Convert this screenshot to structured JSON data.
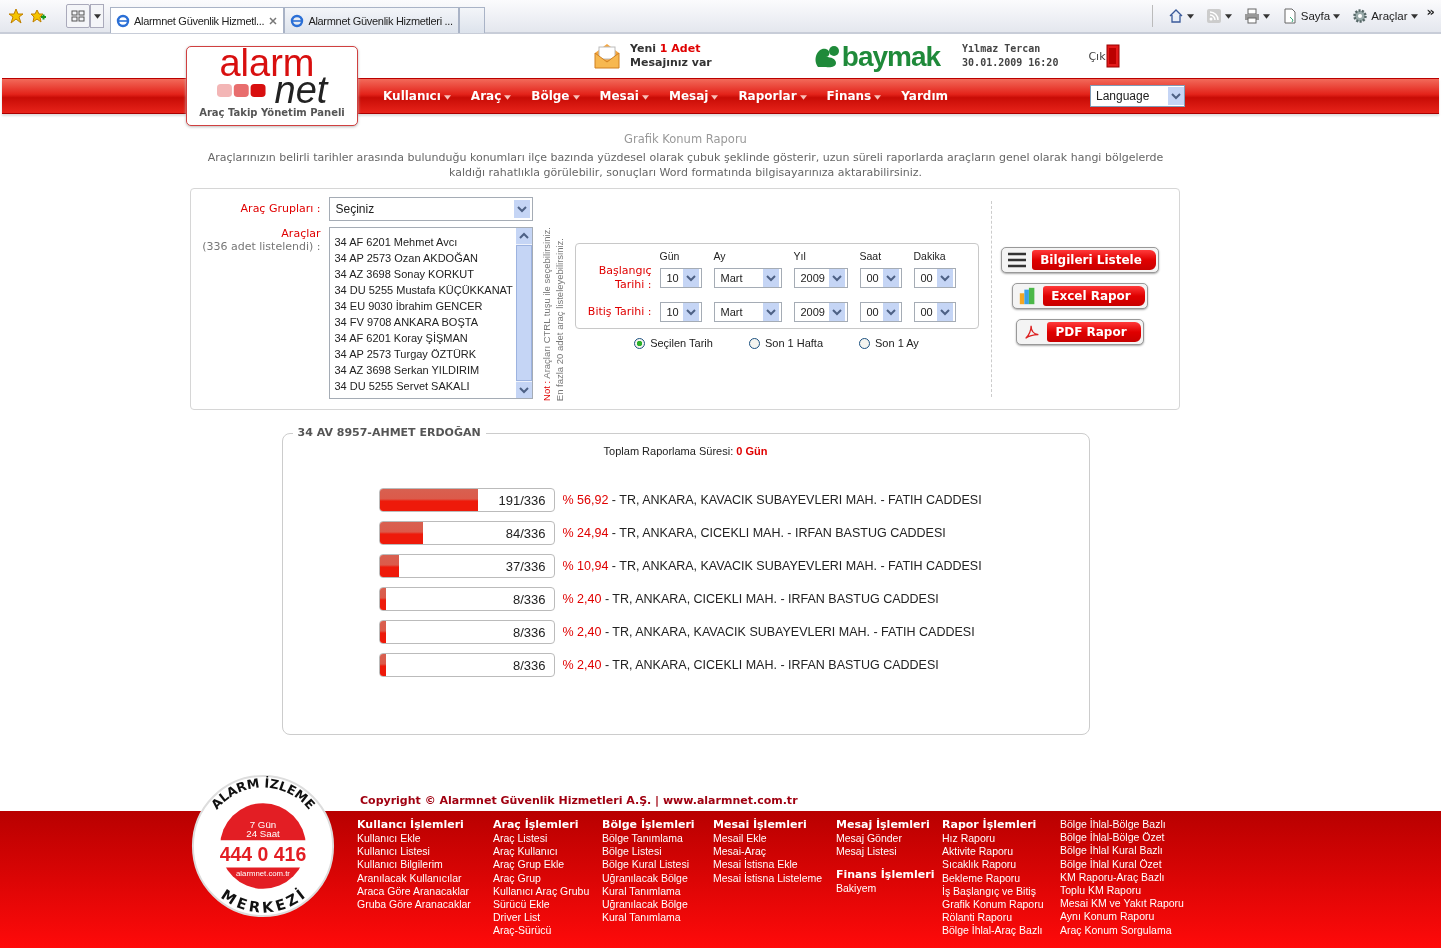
{
  "browser": {
    "tabs": [
      {
        "title": "Alarmnet Güvenlik Hizmetl...",
        "selected": true
      },
      {
        "title": "Alarmnet Güvenlik Hizmetleri ...",
        "selected": false
      }
    ],
    "tools": [
      {
        "kind": "home"
      },
      {
        "kind": "feed"
      },
      {
        "kind": "print"
      },
      {
        "kind": "page",
        "label": "Sayfa"
      },
      {
        "kind": "gear",
        "label": "Araçlar"
      }
    ],
    "more": "»"
  },
  "header": {
    "logo": {
      "word1": "alarm",
      "word2": "net",
      "tagline": "Araç Takip Yönetim Paneli"
    },
    "message": {
      "prefix": "Yeni",
      "count": "1 Adet",
      "text": "Mesajınız var"
    },
    "brand": "baymak",
    "user": "Yılmaz Tercan",
    "datetime": "30.01.2009 16:20",
    "logout": "Çık",
    "nav": [
      {
        "label": "Kullanıcı",
        "has_menu": true
      },
      {
        "label": "Araç",
        "has_menu": true
      },
      {
        "label": "Bölge",
        "has_menu": true
      },
      {
        "label": "Mesai",
        "has_menu": true
      },
      {
        "label": "Mesaj",
        "has_menu": true
      },
      {
        "label": "Raporlar",
        "has_menu": true
      },
      {
        "label": "Finans",
        "has_menu": true
      },
      {
        "label": "Yardım",
        "has_menu": false
      }
    ],
    "language": "Language"
  },
  "page": {
    "title": "Grafik Konum Raporu",
    "description": "Araçlarınızın belirli tarihler arasında bulunduğu konumları ilçe bazında yüzdesel olarak çubuk şeklinde gösterir, uzun süreli raporlarda araçların genel olarak hangi bölgelerde kaldığı rahatlıkla görülebilir, sonuçları Word formatında bilgisayarınıza aktarabilirsiniz."
  },
  "form": {
    "group_label": "Araç Grupları :",
    "group_value": "Seçiniz",
    "vehicles_label": "Araçlar",
    "vehicles_count": "(336 adet listelendi) :",
    "vehicles": [
      "34 AF 6201 Mehmet Avcı",
      "34 AP 2573 Ozan AKDOĞAN",
      "34 AZ 3698 Sonay KORKUT",
      "34 DU 5255 Mustafa KÜÇÜKKANAT",
      "34 EU 9030 İbrahim GENCER",
      "34 FV 9708 ANKARA BOŞTA",
      "34 AF 6201 Koray ŞİŞMAN",
      "34 AP 2573 Turgay ÖZTÜRK",
      "34 AZ 3698 Serkan YILDIRIM",
      "34 DU 5255 Servet SAKALI"
    ],
    "note_prefix": "Not :",
    "note_lines": [
      "Araçları CTRL tuşu ile seçebilirsiniz.",
      "En fazla 20 adet araç listeleyebilirsiniz."
    ],
    "date_columns": [
      "Gün",
      "Ay",
      "Yıl",
      "Saat",
      "Dakika"
    ],
    "date_rows": [
      {
        "label": "Başlangıç Tarihi :",
        "values": [
          "10",
          "Mart",
          "2009",
          "00",
          "00"
        ]
      },
      {
        "label": "Bitiş Tarihi :",
        "values": [
          "10",
          "Mart",
          "2009",
          "00",
          "00"
        ]
      }
    ],
    "ranges": [
      {
        "label": "Seçilen Tarih",
        "selected": true
      },
      {
        "label": "Son 1 Hafta",
        "selected": false
      },
      {
        "label": "Son 1 Ay",
        "selected": false
      }
    ],
    "buttons": [
      {
        "label": "Bilgileri Listele",
        "kind": "list"
      },
      {
        "label": "Excel Rapor",
        "kind": "excel"
      },
      {
        "label": "PDF Rapor",
        "kind": "pdf"
      }
    ]
  },
  "report": {
    "title": "34 AV 8957-AHMET ERDOĞAN",
    "total_label": "Toplam Raporlama Süresi:",
    "total_value": "0 Gün",
    "rows": [
      {
        "level": 0.5685,
        "count": "191/336",
        "percent": "% 56,92",
        "address": "- TR, ANKARA, KAVACIK SUBAYEVLERI MAH. - FATIH CADDESI"
      },
      {
        "level": 0.25,
        "count": "84/336",
        "percent": "% 24,94",
        "address": "- TR, ANKARA, CICEKLI MAH. - IRFAN BASTUG CADDESI"
      },
      {
        "level": 0.11,
        "count": "37/336",
        "percent": "% 10,94",
        "address": "- TR, ANKARA, KAVACIK SUBAYEVLERI MAH. - FATIH CADDESI"
      },
      {
        "level": 0.024,
        "count": "8/336",
        "percent": "% 2,40",
        "address": "- TR, ANKARA, CICEKLI MAH. - IRFAN BASTUG CADDESI"
      },
      {
        "level": 0.024,
        "count": "8/336",
        "percent": "% 2,40",
        "address": "- TR, ANKARA, KAVACIK SUBAYEVLERI MAH. - FATIH CADDESI"
      },
      {
        "level": 0.024,
        "count": "8/336",
        "percent": "% 2,40",
        "address": "- TR, ANKARA, CICEKLI MAH. - IRFAN BASTUG CADDESI"
      }
    ]
  },
  "footer": {
    "badge": {
      "top": "ALARM İZLEME",
      "days": "7 Gün",
      "hours": "24 Saat",
      "phone": "444 0 416",
      "site": "alarmnet.com.tr",
      "bottom": "MERKEZİ"
    },
    "copyright": "Copyright © Alarmnet Güvenlik Hizmetleri A.Ş. | www.alarmnet.com.tr",
    "columns": [
      {
        "sections": [
          {
            "title": "Kullancı İşlemleri",
            "links": [
              "Kullanıcı Ekle",
              "Kullanıcı Listesi",
              "Kullanıcı Bilgilerim",
              "Aranılacak Kullanıcılar",
              "Araca Göre Aranacaklar",
              "Gruba Göre Aranacaklar"
            ]
          }
        ]
      },
      {
        "sections": [
          {
            "title": "Araç İşlemleri",
            "links": [
              "Araç Listesi",
              "Araç Kullanıcı",
              "Araç Grup Ekle",
              "Araç Grup",
              "Kullanıcı Araç Grubu",
              "Sürücü Ekle",
              "Driver List",
              "Araç-Sürücü"
            ]
          }
        ]
      },
      {
        "sections": [
          {
            "title": "Bölge İşlemleri",
            "links": [
              "Bölge Tanımlama",
              "Bölge Listesi",
              "Bölge Kural Listesi",
              "Uğranılacak Bölge",
              "Kural Tanımlama",
              "Uğranılacak Bölge",
              "Kural Tanımlama"
            ]
          }
        ]
      },
      {
        "sections": [
          {
            "title": "Mesai İşlemleri",
            "links": [
              "Mesail Ekle",
              "Mesai-Araç",
              "Mesai İstisna Ekle",
              "Mesai İstisna Listeleme"
            ]
          }
        ]
      },
      {
        "sections": [
          {
            "title": "Mesaj İşlemleri",
            "links": [
              "Mesaj Gönder",
              "Mesaj Listesi"
            ]
          },
          {
            "title": "Finans İşlemleri",
            "links": [
              "Bakiyem"
            ]
          }
        ]
      },
      {
        "sections": [
          {
            "title": "Rapor İşlemleri",
            "links": [
              "Hız Raporu",
              "Aktivite Raporu",
              "Sıcaklık Raporu",
              "Bekleme Raporu",
              "İş Başlangıç ve Bitiş",
              "Grafik Konum Raporu",
              "Rölanti Raporu",
              "Bölge İhlal-Araç Bazlı"
            ]
          }
        ]
      },
      {
        "sections": [
          {
            "links": [
              "Bölge İhlal-Bölge Bazlı",
              "Bölge İhlal-Bölge Özet",
              "Bölge İhlal Kural Bazlı",
              "Bölge İhlal Kural Özet",
              "KM Raporu-Araç Bazlı",
              "Toplu KM Raporu",
              "Mesai KM ve Yakıt Raporu",
              "Aynı Konum Raporu",
              "Araç Konum Sorgulama"
            ]
          }
        ]
      }
    ]
  }
}
